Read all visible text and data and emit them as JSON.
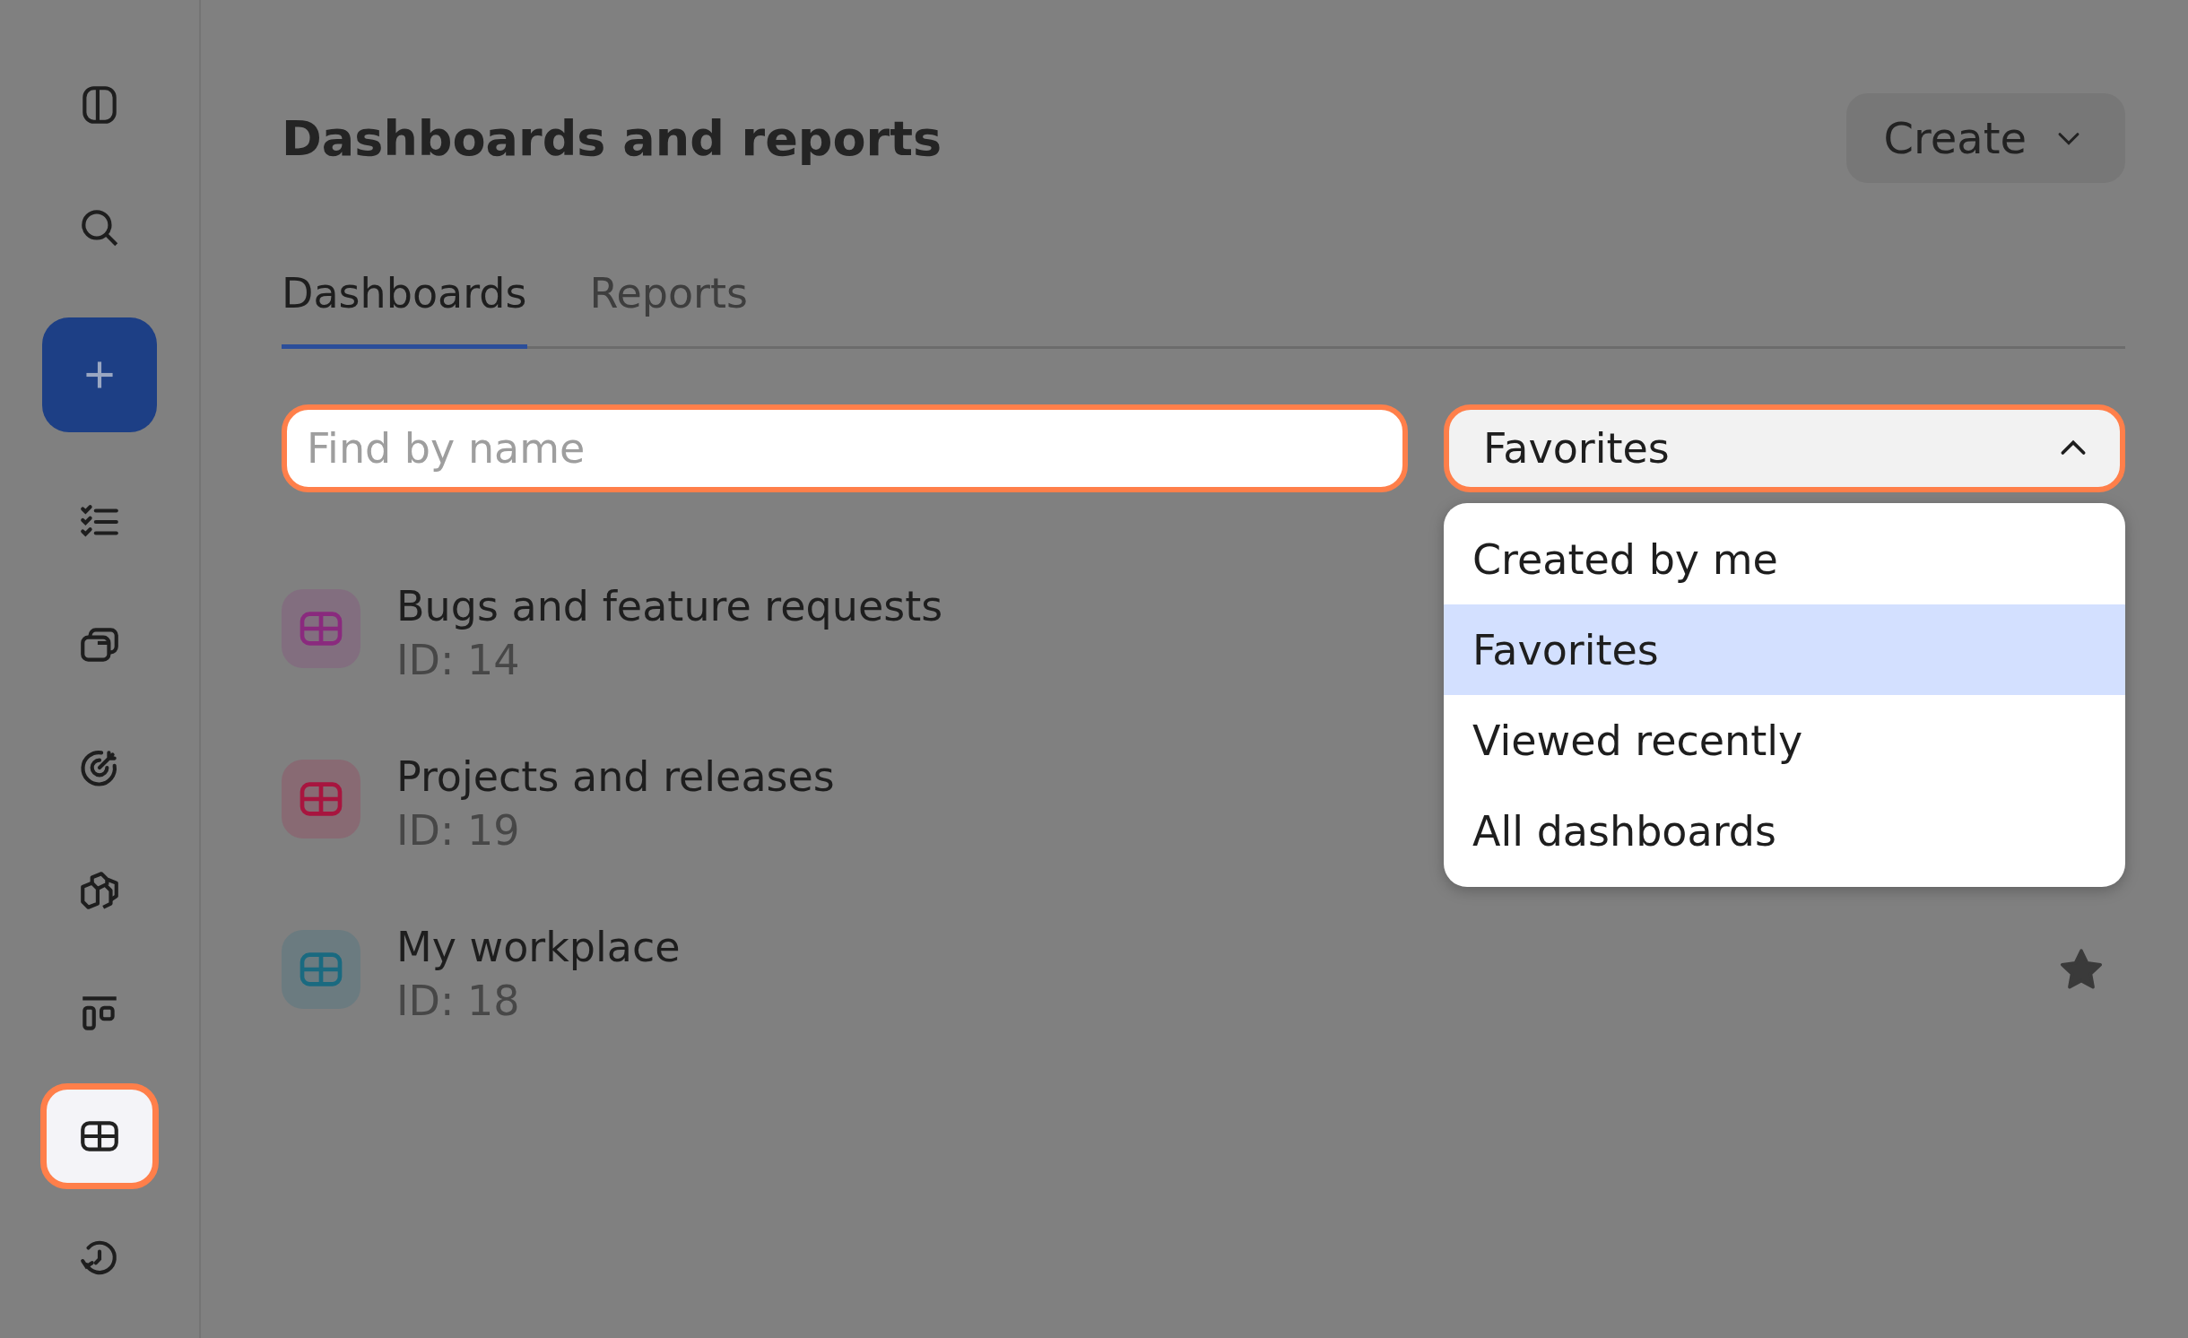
{
  "sidebar": {
    "items": [
      {
        "kind": "panel",
        "selected": false
      },
      {
        "kind": "search",
        "selected": false
      },
      {
        "kind": "create",
        "selected": false
      },
      {
        "kind": "checklist",
        "selected": false
      },
      {
        "kind": "folders",
        "selected": false
      },
      {
        "kind": "target",
        "selected": false
      },
      {
        "kind": "cubes",
        "selected": false
      },
      {
        "kind": "board",
        "selected": false
      },
      {
        "kind": "dashboard",
        "selected": true
      },
      {
        "kind": "history",
        "selected": false
      }
    ]
  },
  "header": {
    "title": "Dashboards and reports",
    "create_button": "Create"
  },
  "tabs": [
    {
      "label": "Dashboards",
      "selected": true
    },
    {
      "label": "Reports",
      "selected": false
    }
  ],
  "search": {
    "placeholder": "Find by name"
  },
  "filter": {
    "value": "Favorites",
    "expanded": true,
    "options": [
      {
        "label": "Created by me",
        "selected": false
      },
      {
        "label": "Favorites",
        "selected": true
      },
      {
        "label": "Viewed recently",
        "selected": false
      },
      {
        "label": "All dashboards",
        "selected": false
      }
    ]
  },
  "dashboards": [
    {
      "name": "Bugs and feature requests",
      "id": "ID: 14",
      "color": "#8a2a7e"
    },
    {
      "name": "Projects and releases",
      "id": "ID: 19",
      "color": "#a8153f"
    },
    {
      "name": "My workplace",
      "id": "ID: 18",
      "color": "#1a6a80",
      "starred": true
    }
  ]
}
